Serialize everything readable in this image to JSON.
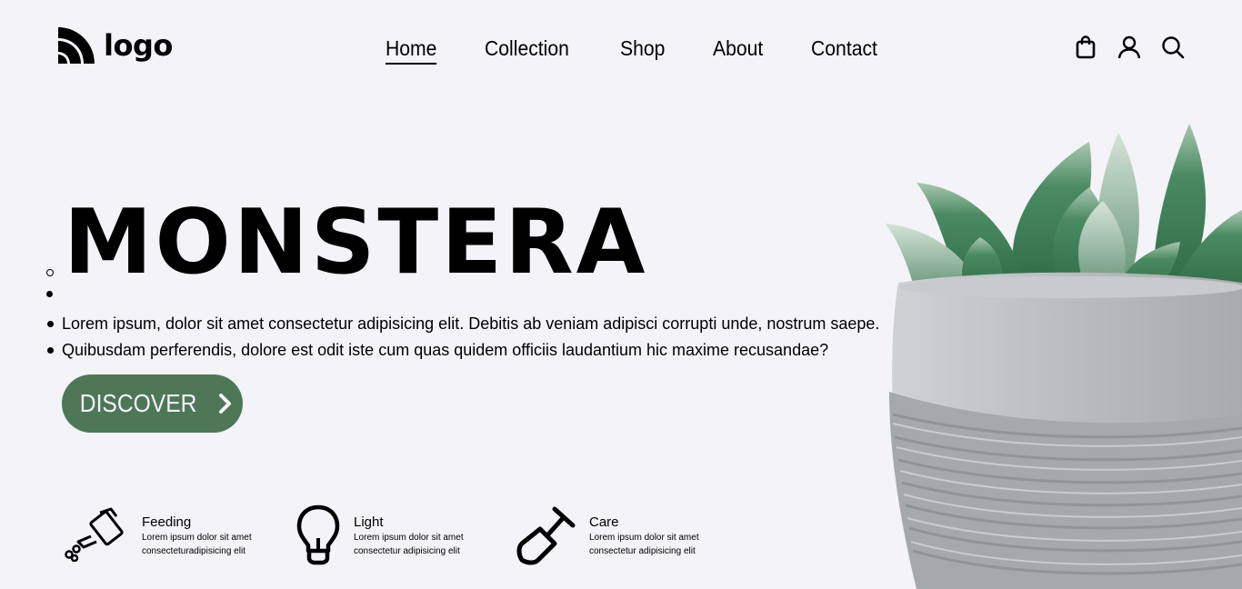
{
  "header": {
    "logo_text": "logo",
    "nav": [
      {
        "label": "Home",
        "active": true
      },
      {
        "label": "Collection"
      },
      {
        "label": "Shop"
      },
      {
        "label": "About"
      },
      {
        "label": "Contact"
      }
    ],
    "icons": [
      "shopping-bag-icon",
      "user-icon",
      "search-icon"
    ]
  },
  "hero": {
    "title": "MONSTERA",
    "bullets": [
      "Lorem ipsum, dolor sit amet consectetur adipisicing elit. Debitis ab veniam adipisci corrupti unde, nostrum saepe.",
      "Quibusdam perferendis, dolore est odit iste cum quas quidem officiis laudantium hic maxime recusandae?"
    ],
    "discover_label": "DISCOVER",
    "image": "succulent-in-concrete-pot"
  },
  "features": [
    {
      "icon": "watering-can-icon",
      "title": "Feeding",
      "desc": "Lorem ipsum dolor sit amet consecteturadipisicing elit"
    },
    {
      "icon": "lightbulb-icon",
      "title": "Light",
      "desc": "Lorem ipsum dolor sit amet consectetur adipisicing elit"
    },
    {
      "icon": "shovel-icon",
      "title": "Care",
      "desc": "Lorem ipsum dolor sit amet consectetur adipisicing elit"
    }
  ],
  "colors": {
    "background": "#f3f3f8",
    "accent": "#4e7758",
    "text": "#000000"
  }
}
